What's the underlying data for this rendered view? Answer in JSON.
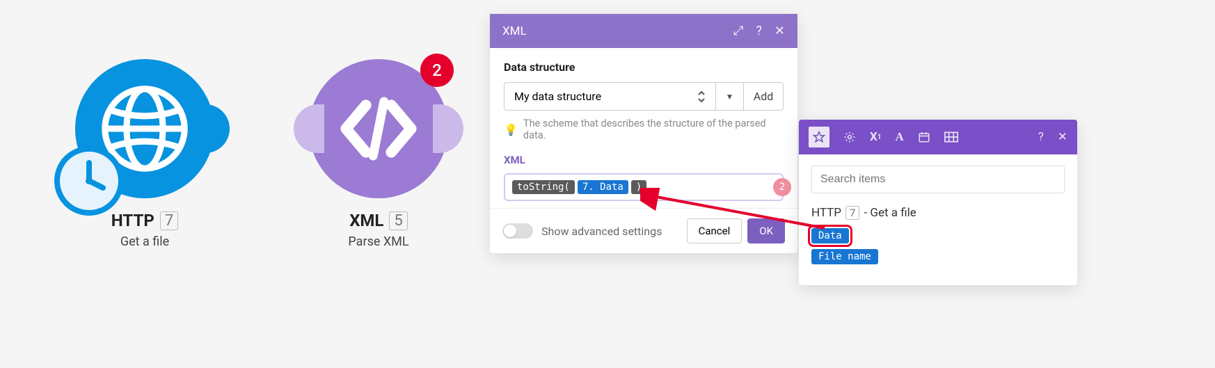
{
  "modules": {
    "http": {
      "title": "HTTP",
      "index": "7",
      "subtitle": "Get a file"
    },
    "xml": {
      "title": "XML",
      "index": "5",
      "subtitle": "Parse XML",
      "badge": "2"
    }
  },
  "panel": {
    "title": "XML",
    "section_label": "Data structure",
    "ds_selected": "My data structure",
    "add_label": "Add",
    "hint": "The scheme that describes the structure of the parsed data.",
    "field_label": "XML",
    "expr": {
      "fn_open": "toString(",
      "var": "7. Data",
      "fn_close": ")",
      "badge": "2"
    },
    "advanced": "Show advanced settings",
    "cancel": "Cancel",
    "ok": "OK"
  },
  "mapper": {
    "search_placeholder": "Search items",
    "source_app": "HTTP",
    "source_index": "7",
    "source_label": "- Get a file",
    "pill_data": "Data",
    "pill_filename": "File name"
  }
}
